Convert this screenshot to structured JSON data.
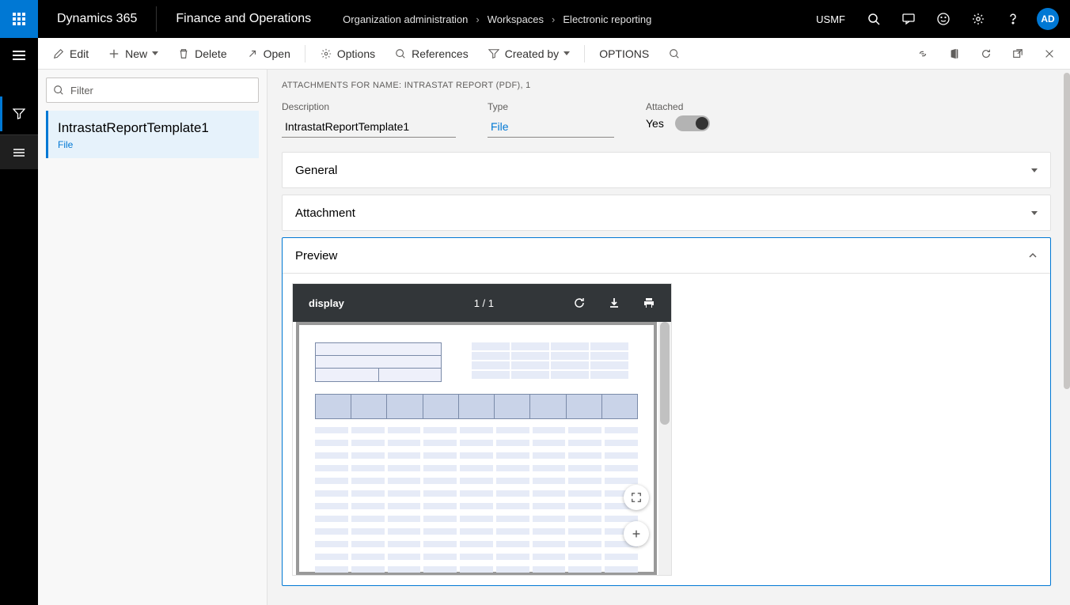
{
  "topbar": {
    "brand": "Dynamics 365",
    "module": "Finance and Operations",
    "breadcrumbs": [
      "Organization administration",
      "Workspaces",
      "Electronic reporting"
    ],
    "entity": "USMF",
    "avatar": "AD"
  },
  "commandbar": {
    "edit": "Edit",
    "new": "New",
    "delete": "Delete",
    "open": "Open",
    "options": "Options",
    "references": "References",
    "createdby": "Created by",
    "options_caps": "OPTIONS"
  },
  "leftpanel": {
    "filter_placeholder": "Filter",
    "item_title": "IntrastatReportTemplate1",
    "item_sub": "File"
  },
  "main": {
    "page_label": "ATTACHMENTS FOR NAME: INTRASTAT REPORT (PDF), 1",
    "fields": {
      "description_label": "Description",
      "description_value": "IntrastatReportTemplate1",
      "type_label": "Type",
      "type_value": "File",
      "attached_label": "Attached",
      "attached_value": "Yes"
    },
    "accordions": {
      "general": "General",
      "attachment": "Attachment",
      "preview": "Preview"
    },
    "pdf": {
      "title": "display",
      "page": "1 / 1"
    }
  }
}
